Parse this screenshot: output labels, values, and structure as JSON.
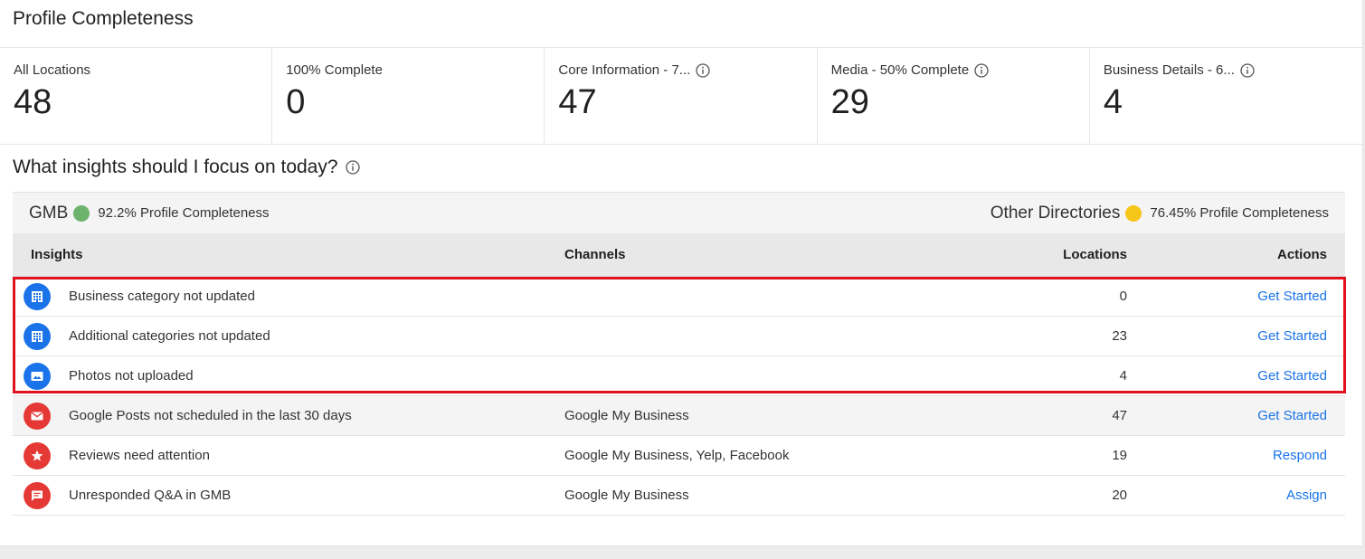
{
  "page_title": "Profile Completeness",
  "stats": [
    {
      "label": "All Locations",
      "value": "48",
      "info": false
    },
    {
      "label": "100% Complete",
      "value": "0",
      "info": false
    },
    {
      "label": "Core Information - 7...",
      "value": "47",
      "info": true
    },
    {
      "label": "Media - 50% Complete",
      "value": "29",
      "info": true
    },
    {
      "label": "Business Details - 6...",
      "value": "4",
      "info": true
    }
  ],
  "insights_section": {
    "title": "What insights should I focus on today?",
    "summary": {
      "left": {
        "name": "GMB",
        "percent": "92.2% Profile Completeness",
        "dot_color": "#6db36d"
      },
      "right": {
        "name": "Other Directories",
        "percent": "76.45% Profile Completeness",
        "dot_color": "#f5c518"
      }
    },
    "headers": {
      "insights": "Insights",
      "channels": "Channels",
      "locations": "Locations",
      "actions": "Actions"
    },
    "rows": [
      {
        "icon": "business-icon",
        "icon_color": "#1a73e8",
        "insight": "Business category not updated",
        "channels": "",
        "locations": "0",
        "action": "Get Started"
      },
      {
        "icon": "business-icon",
        "icon_color": "#1a73e8",
        "insight": "Additional categories not updated",
        "channels": "",
        "locations": "23",
        "action": "Get Started"
      },
      {
        "icon": "photo-icon",
        "icon_color": "#1a73e8",
        "insight": "Photos not uploaded",
        "channels": "",
        "locations": "4",
        "action": "Get Started"
      },
      {
        "icon": "mail-icon",
        "icon_color": "#e53935",
        "insight": "Google Posts not scheduled in the last 30 days",
        "channels": "Google My Business",
        "locations": "47",
        "action": "Get Started"
      },
      {
        "icon": "star-icon",
        "icon_color": "#e53935",
        "insight": "Reviews need attention",
        "channels": "Google My Business, Yelp, Facebook",
        "locations": "19",
        "action": "Respond"
      },
      {
        "icon": "chat-icon",
        "icon_color": "#e53935",
        "insight": "Unresponded Q&A in GMB",
        "channels": "Google My Business",
        "locations": "20",
        "action": "Assign"
      }
    ]
  },
  "colors": {
    "accent_link": "#1a73e8",
    "highlight_border": "#e2111e"
  }
}
